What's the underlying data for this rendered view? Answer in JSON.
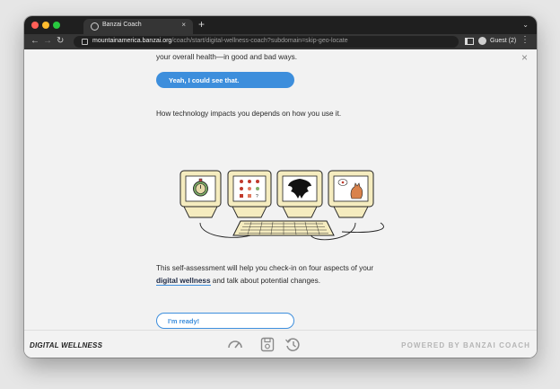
{
  "browser": {
    "tab_title": "Banzai Coach",
    "tab_close": "×",
    "new_tab": "+",
    "url_host": "mountainamerica.banzai.org",
    "url_path": "/coach/start/digital-wellness-coach?subdomain=skip-geo-locate",
    "profile_label": "Guest (2)",
    "traffic_lights": [
      "#ff5f57",
      "#febc2e",
      "#28c840"
    ]
  },
  "content": {
    "line1": "your overall health—in good and bad ways.",
    "button1": "Yeah, I could see that.",
    "line2": "How technology impacts you depends on how you use it.",
    "para_line1": "This self-assessment will help you check-in on four aspects of your",
    "para_link": "digital wellness",
    "para_rest": " and talk about potential changes.",
    "button2": "I'm ready!",
    "close": "×"
  },
  "footer": {
    "brand": "DIGITAL WELLNESS",
    "powered": "POWERED BY BANZAI COACH"
  },
  "colors": {
    "accent": "#3d8edc",
    "screen_frame": "#f5ecbf"
  }
}
